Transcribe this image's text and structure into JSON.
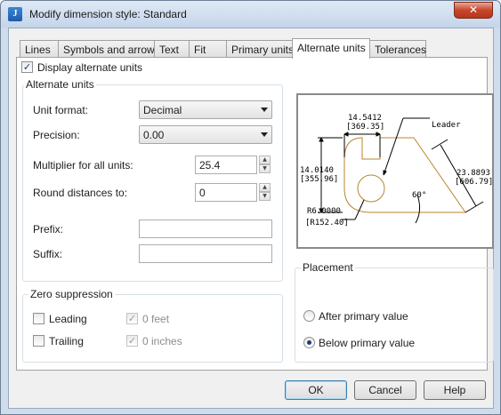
{
  "window": {
    "title": "Modify dimension style: Standard",
    "close_glyph": "✕"
  },
  "tabs": [
    {
      "label": "Lines"
    },
    {
      "label": "Symbols and arrows"
    },
    {
      "label": "Text"
    },
    {
      "label": "Fit"
    },
    {
      "label": "Primary units"
    },
    {
      "label": "Alternate units",
      "active": true
    },
    {
      "label": "Tolerances"
    }
  ],
  "display_alt": {
    "label": "Display alternate units",
    "checked": true
  },
  "alternate_units": {
    "title": "Alternate units",
    "unit_format": {
      "label": "Unit format:",
      "value": "Decimal"
    },
    "precision": {
      "label": "Precision:",
      "value": "0.00"
    },
    "multiplier": {
      "label": "Multiplier for all units:",
      "value": "25.4"
    },
    "round": {
      "label": "Round distances to:",
      "value": "0"
    },
    "prefix": {
      "label": "Prefix:",
      "value": ""
    },
    "suffix": {
      "label": "Suffix:",
      "value": ""
    }
  },
  "zero_suppression": {
    "title": "Zero suppression",
    "leading": {
      "label": "Leading",
      "checked": false
    },
    "trailing": {
      "label": "Trailing",
      "checked": false
    },
    "feet": {
      "label": "0 feet",
      "checked": true,
      "enabled": false
    },
    "inches": {
      "label": "0 inches",
      "checked": true,
      "enabled": false
    }
  },
  "preview": {
    "top_dim_primary": "14.5412",
    "top_dim_alt": "[369.35]",
    "left_dim_primary": "14.0140",
    "left_dim_alt": "[355.96]",
    "right_dim_primary": "23.8893",
    "right_dim_alt": "[606.79]",
    "radius_primary": "R6.0000",
    "radius_alt": "[R152.40]",
    "angle": "60°",
    "leader": "Leader",
    "colors": {
      "part": "#b8862e",
      "dims": "#000000"
    }
  },
  "placement": {
    "title": "Placement",
    "after": {
      "label": "After primary value",
      "selected": false
    },
    "below": {
      "label": "Below primary value",
      "selected": true
    }
  },
  "buttons": {
    "ok": "OK",
    "cancel": "Cancel",
    "help": "Help"
  }
}
